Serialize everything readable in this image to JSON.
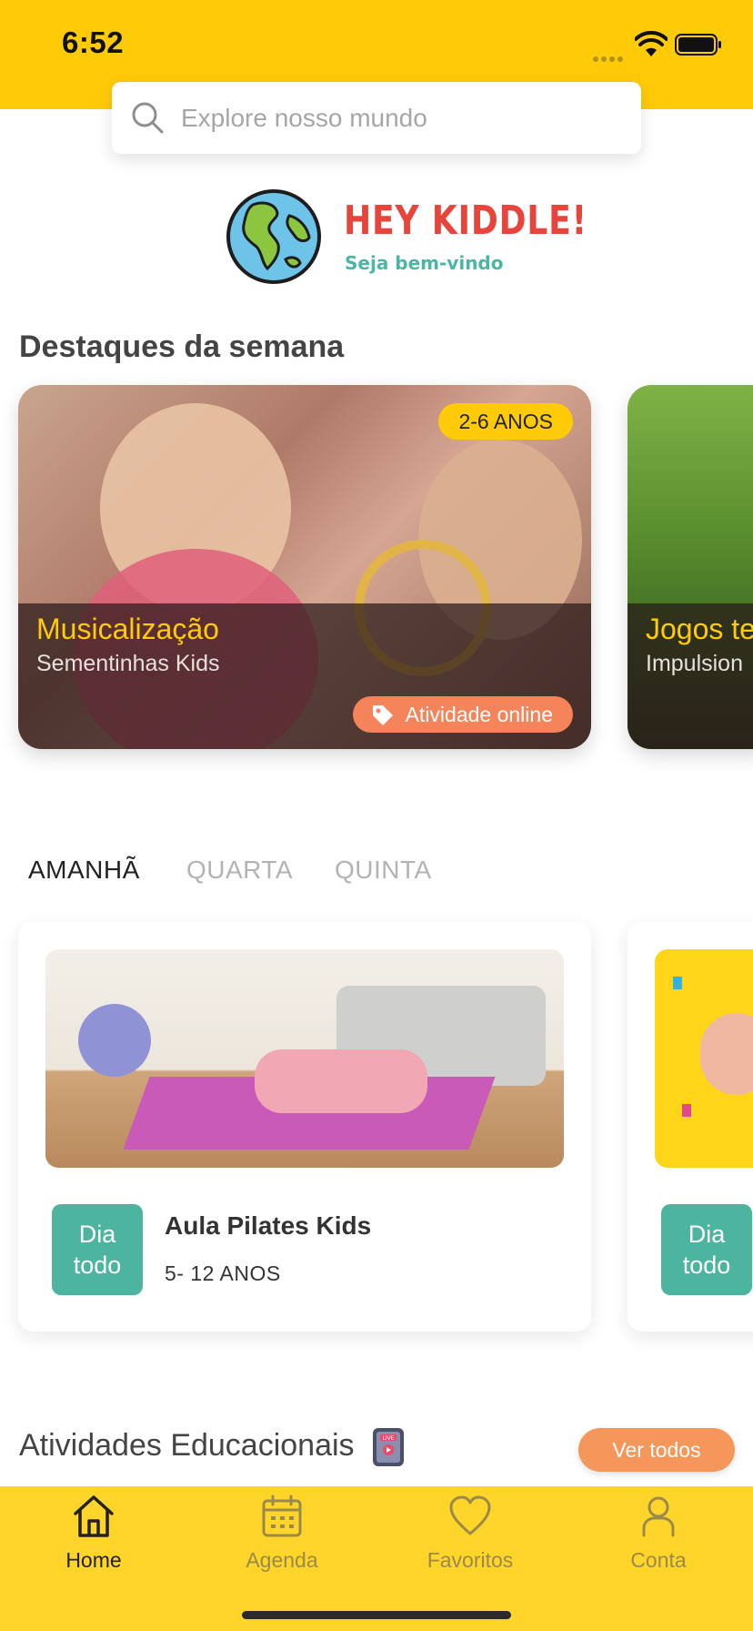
{
  "status_bar": {
    "time": "6:52"
  },
  "search": {
    "placeholder": "Explore nosso mundo"
  },
  "logo": {
    "title": "HEY KIDDLE!",
    "subtitle": "Seja bem-vindo"
  },
  "highlights": {
    "title": "Destaques da semana",
    "cards": [
      {
        "age": "2-6 ANOS",
        "title": "Musicalização",
        "subtitle": "Sementinhas Kids",
        "tag": "Atividade online"
      },
      {
        "title": "Jogos te",
        "subtitle": "Impulsion"
      }
    ]
  },
  "day_tabs": [
    {
      "label": "AMANHÃ",
      "active": true
    },
    {
      "label": "QUARTA",
      "active": false
    },
    {
      "label": "QUINTA",
      "active": false
    }
  ],
  "events": [
    {
      "badge_line1": "Dia",
      "badge_line2": "todo",
      "title": "Aula Pilates Kids",
      "age": "5- 12 ANOS"
    },
    {
      "badge_line1": "Dia",
      "badge_line2": "todo"
    }
  ],
  "educational": {
    "title": "Atividades Educacionais",
    "see_all": "Ver todos",
    "icon": "live-tv-icon"
  },
  "bottom_nav": [
    {
      "label": "Home",
      "icon": "home-icon",
      "active": true
    },
    {
      "label": "Agenda",
      "icon": "calendar-icon",
      "active": false
    },
    {
      "label": "Favoritos",
      "icon": "heart-icon",
      "active": false
    },
    {
      "label": "Conta",
      "icon": "user-icon",
      "active": false
    }
  ],
  "colors": {
    "brand_yellow": "#FFCB08",
    "accent_orange": "#F5845A",
    "teal": "#4DB59F"
  }
}
